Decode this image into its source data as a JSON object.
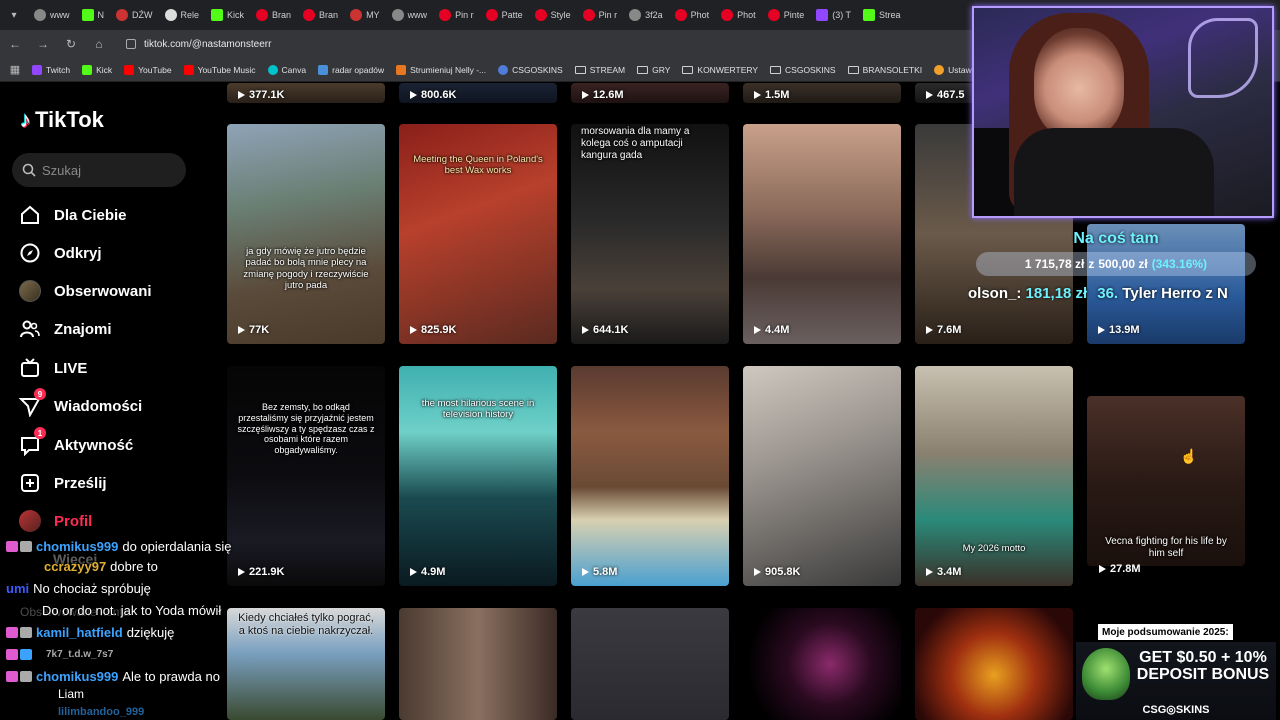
{
  "browser": {
    "tabs": [
      {
        "label": "www",
        "icon": "globe-icon"
      },
      {
        "label": "N",
        "icon": "kick-icon"
      },
      {
        "label": "DŹW",
        "icon": "youtube-icon"
      },
      {
        "label": "Rele",
        "icon": "github-icon"
      },
      {
        "label": "Kick",
        "icon": "kick-icon"
      },
      {
        "label": "Bran",
        "icon": "pinterest-icon"
      },
      {
        "label": "Bran",
        "icon": "pinterest-icon"
      },
      {
        "label": "MY",
        "icon": "youtube-icon"
      },
      {
        "label": "www",
        "icon": "globe-icon"
      },
      {
        "label": "Pin r",
        "icon": "pinterest-icon"
      },
      {
        "label": "Patte",
        "icon": "pinterest-icon"
      },
      {
        "label": "Style",
        "icon": "pinterest-icon"
      },
      {
        "label": "Pin r",
        "icon": "pinterest-icon"
      },
      {
        "label": "3f2a",
        "icon": "globe-icon"
      },
      {
        "label": "Phot",
        "icon": "pinterest-icon"
      },
      {
        "label": "Phot",
        "icon": "pinterest-icon"
      },
      {
        "label": "Pinte",
        "icon": "pinterest-icon"
      },
      {
        "label": "(3) T",
        "icon": "twitch-icon"
      },
      {
        "label": "Strea",
        "icon": "kick-icon"
      }
    ],
    "url": "tiktok.com/@nastamonsteerr",
    "bookmarks": [
      {
        "label": "Twitch",
        "icon": "twitch-icon"
      },
      {
        "label": "Kick",
        "icon": "kick-icon"
      },
      {
        "label": "YouTube",
        "icon": "youtube-icon"
      },
      {
        "label": "YouTube Music",
        "icon": "youtube-music-icon"
      },
      {
        "label": "Canva",
        "icon": "canva-icon"
      },
      {
        "label": "radar opadów",
        "icon": "radar-icon"
      },
      {
        "label": "Strumieniuj Nelly -...",
        "icon": "stream-icon"
      },
      {
        "label": "CSGOSKINS",
        "icon": "csgo-icon"
      },
      {
        "label": "STREAM",
        "icon": "folder-icon"
      },
      {
        "label": "GRY",
        "icon": "folder-icon"
      },
      {
        "label": "KONWERTERY",
        "icon": "folder-icon"
      },
      {
        "label": "CSGOSKINS",
        "icon": "folder-icon"
      },
      {
        "label": "BRANSOLETKI",
        "icon": "folder-icon"
      },
      {
        "label": "Ustawienia strumien...",
        "icon": "settings-icon"
      }
    ]
  },
  "sidebar": {
    "logo": "TikTok",
    "search_placeholder": "Szukaj",
    "items": [
      {
        "label": "Dla Ciebie",
        "icon": "home-icon"
      },
      {
        "label": "Odkryj",
        "icon": "compass-icon"
      },
      {
        "label": "Obserwowani",
        "icon": "avatar"
      },
      {
        "label": "Znajomi",
        "icon": "friends-icon"
      },
      {
        "label": "LIVE",
        "icon": "live-tv-icon"
      },
      {
        "label": "Wiadomości",
        "icon": "send-icon",
        "badge": "9"
      },
      {
        "label": "Aktywność",
        "icon": "inbox-icon",
        "badge": "1"
      },
      {
        "label": "Prześlij",
        "icon": "upload-icon"
      },
      {
        "label": "Profil",
        "icon": "profile-avatar"
      }
    ]
  },
  "videos": {
    "top_row": [
      "377.1K",
      "800.6K",
      "12.6M",
      "1.5M",
      "467.5"
    ],
    "row1": [
      {
        "views": "77K",
        "caption": "ja gdy mówię że jutro będzie padać bo bolą mnie plecy na zmianę pogody i rzeczywiście jutro pada"
      },
      {
        "views": "825.9K",
        "caption": "Meeting the Queen in Poland's best Wax works"
      },
      {
        "views": "644.1K",
        "caption": "morsowania dla mamy a kolega coś o amputacji kangura gada"
      },
      {
        "views": "4.4M",
        "caption": ""
      },
      {
        "views": "7.6M",
        "caption": ""
      },
      {
        "views": "13.9M",
        "caption": ""
      }
    ],
    "row2": [
      {
        "views": "221.9K",
        "caption": "Bez zemsty, bo odkąd przestaliśmy się przyjaźnić jestem szczęśliwszy a ty spędzasz czas z osobami które razem obgadywaliśmy."
      },
      {
        "views": "4.9M",
        "caption": "the most hilarious scene in television history"
      },
      {
        "views": "5.8M",
        "caption": ""
      },
      {
        "views": "905.8K",
        "caption": ""
      },
      {
        "views": "3.4M",
        "caption": "My 2026 motto"
      },
      {
        "views": "27.8M",
        "caption": "Vecna fighting for his life by him self"
      }
    ],
    "row3": [
      {
        "caption": "Kiedy chciałeś tylko pograć, a ktoś na ciebie nakrzyczał."
      },
      {
        "caption": ""
      },
      {
        "caption": ""
      },
      {
        "caption": ""
      },
      {
        "caption": ""
      }
    ]
  },
  "stream": {
    "goal_title": "Na coś tam",
    "goal_current": "1 715,78 zł",
    "goal_sep": "z",
    "goal_target": "500,00 zł",
    "goal_pct": "(343.16%)",
    "ticker": [
      {
        "name": "olson_:",
        "amount": "181,18 zł"
      },
      {
        "name": "Tyler Herro z N",
        "amount": "36."
      }
    ],
    "chat": [
      {
        "user": "chomikus999",
        "color": "#3ba3ff",
        "msg": "do opierdalania się"
      },
      {
        "user": "ccrazyy97",
        "color": "#e0b030",
        "msg": "dobre to"
      },
      {
        "user": "umi",
        "color": "#3b5bff",
        "msg": "No chociaż spróbuję"
      },
      {
        "user": "",
        "color": "#fff",
        "msg": "Do or do not. jak to Yoda mówił"
      },
      {
        "user": "kamil_hatfield",
        "color": "#3ba3ff",
        "msg": "dziękuję"
      },
      {
        "user": "7k7_t.d.w_7s7",
        "color": "#aaa",
        "msg": ""
      },
      {
        "user": "chomikus999",
        "color": "#3ba3ff",
        "msg": "Ale to prawda no"
      },
      {
        "user": "Liam",
        "color": "#fff",
        "msg": ""
      }
    ],
    "ghost_labels": [
      "Więcej",
      "Obserwowane konta",
      "lilimbandoo_999"
    ]
  },
  "promo": {
    "title": "Moje podsumowanie 2025:",
    "offer": "GET $0.50 + 10% DEPOSIT BONUS",
    "brand": "CSG◎SKINS"
  }
}
